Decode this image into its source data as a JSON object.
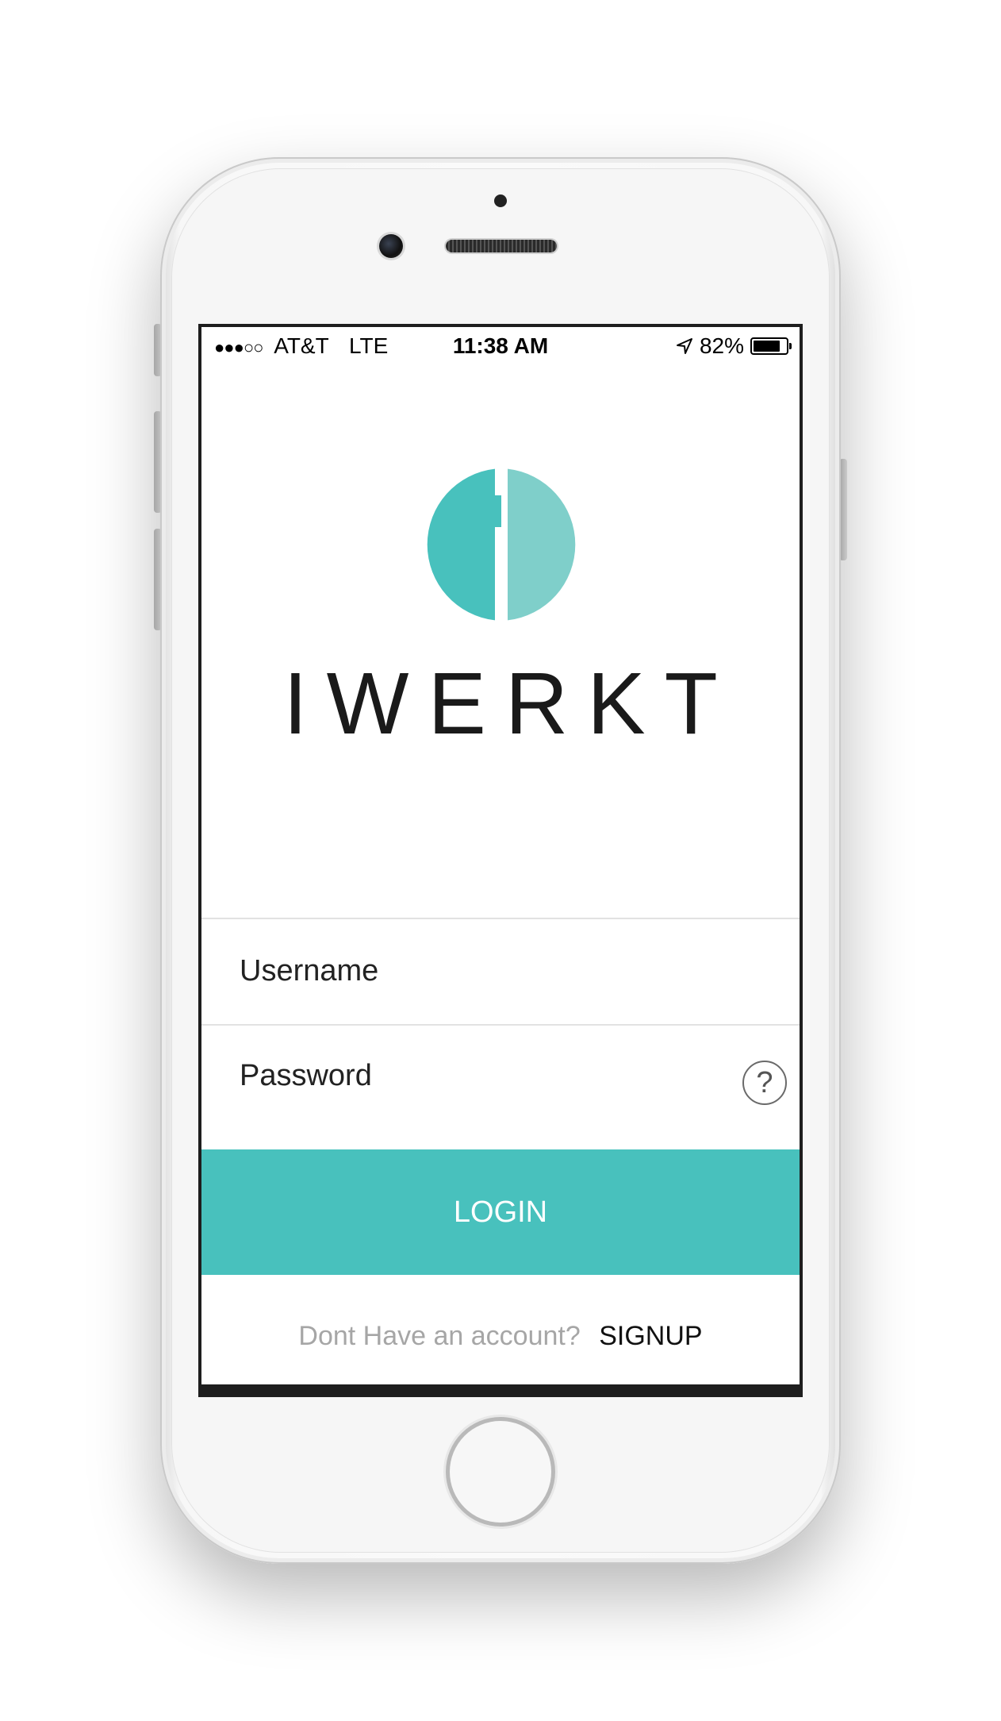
{
  "status_bar": {
    "signal": "●●●○○",
    "carrier": "AT&T",
    "network": "LTE",
    "time": "11:38 AM",
    "battery_percent": "82%",
    "battery_level": 0.82,
    "location_icon": "location-arrow-icon"
  },
  "brand": {
    "name": "IWERKT",
    "logo_colors": [
      "#48c1bd",
      "#7fcfca"
    ]
  },
  "form": {
    "username_placeholder": "Username",
    "password_placeholder": "Password",
    "help_glyph": "?"
  },
  "login_button": {
    "label": "LOGIN",
    "color": "#48c1bd"
  },
  "signup": {
    "prompt": "Dont Have an account?",
    "link_label": "SIGNUP"
  }
}
